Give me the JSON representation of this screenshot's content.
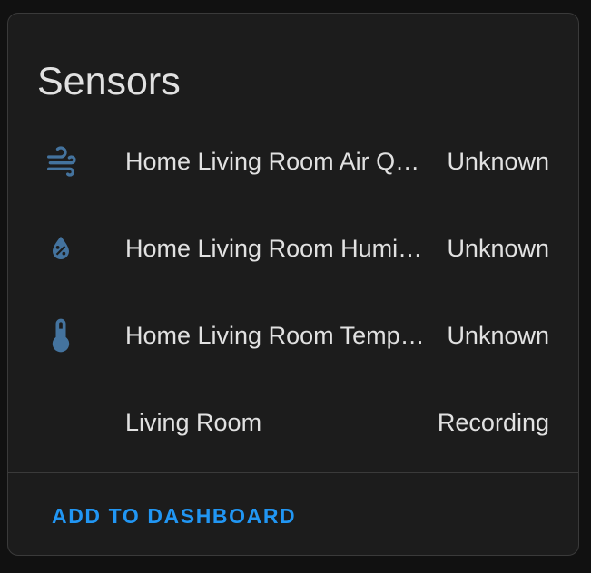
{
  "card": {
    "title": "Sensors"
  },
  "entities": [
    {
      "icon": "air-filter-icon",
      "name": "Home Living Room Air Quality",
      "state": "Unknown"
    },
    {
      "icon": "water-percent-icon",
      "name": "Home Living Room Humidity",
      "state": "Unknown"
    },
    {
      "icon": "thermometer-icon",
      "name": "Home Living Room Temperature",
      "state": "Unknown"
    },
    {
      "icon": "",
      "name": "Living Room",
      "state": "Recording"
    }
  ],
  "actions": {
    "add_to_dashboard_label": "ADD TO DASHBOARD"
  },
  "colors": {
    "icon": "#44739e",
    "accent": "#2196f3",
    "text": "#e1e1e1",
    "card_bg": "#1c1c1c"
  }
}
